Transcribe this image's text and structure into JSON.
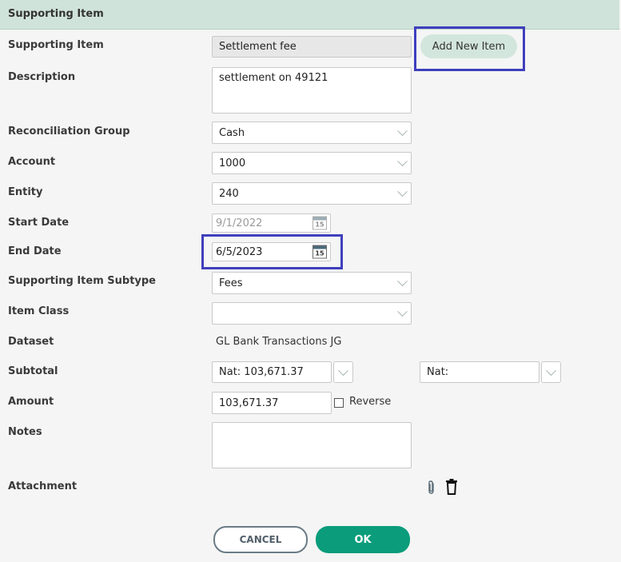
{
  "header": {
    "title": "Supporting Item"
  },
  "labels": {
    "supporting_item": "Supporting Item",
    "description": "Description",
    "reconciliation_group": "Reconciliation Group",
    "account": "Account",
    "entity": "Entity",
    "start_date": "Start Date",
    "end_date": "End Date",
    "subtype": "Supporting Item Subtype",
    "item_class": "Item Class",
    "dataset": "Dataset",
    "subtotal": "Subtotal",
    "amount": "Amount",
    "notes": "Notes",
    "attachment": "Attachment"
  },
  "fields": {
    "supporting_item": "Settlement fee",
    "description": "settlement on 49121",
    "reconciliation_group": "Cash",
    "account": "1000",
    "entity": "240",
    "start_date": "9/1/2022",
    "end_date": "6/5/2023",
    "subtype": "Fees",
    "item_class": "",
    "dataset": "GL Bank Transactions JG",
    "subtotal_left": "Nat: 103,671.37",
    "subtotal_right": "Nat:",
    "amount": "103,671.37",
    "notes": ""
  },
  "calendar_day": "15",
  "reverse_label": "Reverse",
  "reverse_checked": false,
  "buttons": {
    "add_new_item": "Add New Item",
    "cancel": "CANCEL",
    "ok": "OK"
  },
  "icons": {
    "attach": "paperclip-icon",
    "delete": "trash-icon",
    "calendar": "calendar-icon",
    "dropdown": "chevron-down-icon"
  },
  "colors": {
    "header_bg": "#cfe3da",
    "accent": "#0a9c7b",
    "highlight": "#3f3fbd"
  }
}
